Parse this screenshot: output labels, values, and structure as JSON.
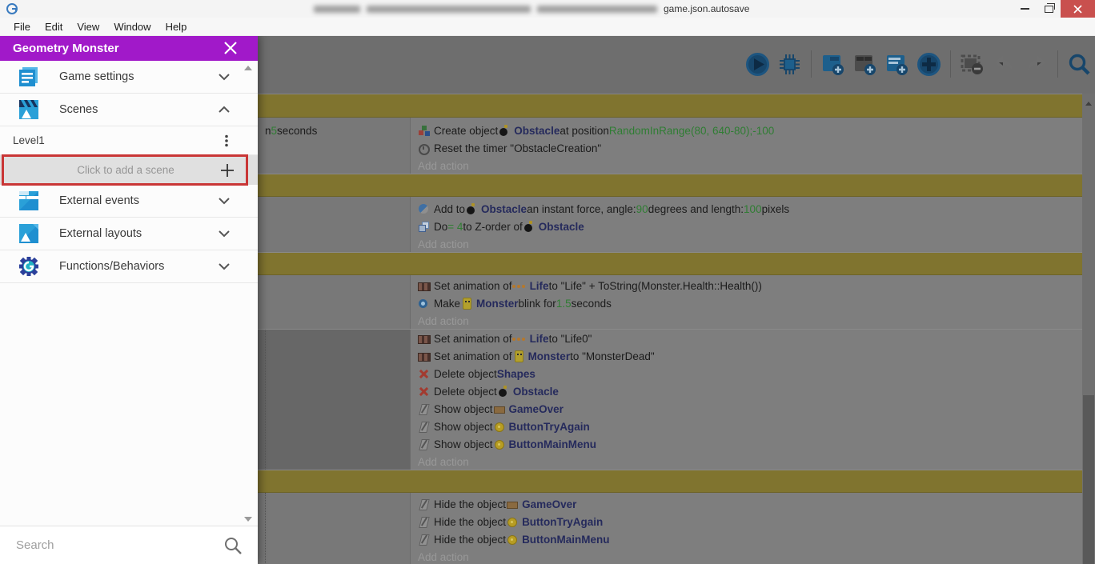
{
  "window": {
    "title_visible": "game.json.autosave",
    "controls": [
      "minimize",
      "restore",
      "close"
    ]
  },
  "menu": {
    "items": [
      "File",
      "Edit",
      "View",
      "Window",
      "Help"
    ]
  },
  "drawer": {
    "title": "Geometry Monster",
    "close_icon": "close-icon",
    "items": [
      {
        "label": "Game settings",
        "icon": "game-settings-icon",
        "chevron": "down"
      },
      {
        "label": "Scenes",
        "icon": "scenes-icon",
        "chevron": "up"
      },
      {
        "label": "Level1",
        "icon": "kebab-menu-icon"
      },
      {
        "label": "Click to add a scene",
        "icon": "plus-icon",
        "highlighted": true
      },
      {
        "label": "External events",
        "icon": "external-events-icon",
        "chevron": "down"
      },
      {
        "label": "External layouts",
        "icon": "external-layouts-icon",
        "chevron": "down"
      },
      {
        "label": "Functions/Behaviors",
        "icon": "functions-behaviors-icon",
        "chevron": "down"
      }
    ],
    "search_placeholder": "Search"
  },
  "toolbar": {
    "icons": [
      "play-icon",
      "debug-icon",
      "add-event-icon",
      "add-subevent-icon",
      "add-comment-icon",
      "add-more-icon",
      "delete-event-icon",
      "undo-icon",
      "redo-icon",
      "search-icon"
    ]
  },
  "colors": {
    "drawer_header": "#A119C9",
    "close_button": "#c9504e",
    "event_group_bar_dimmed": "#80742f",
    "object_link": "#252a5c",
    "expression_green": "#2f7d33",
    "highlight_red": "#c93636"
  },
  "events": [
    {
      "kind": "group-bar"
    },
    {
      "kind": "event",
      "condition": [
        {
          "text": "n ",
          "style": "plain"
        },
        {
          "text": "5",
          "style": "number"
        },
        {
          "text": " seconds",
          "style": "plain"
        }
      ],
      "actions": [
        [
          {
            "icon": "create-object"
          },
          {
            "text": "Create object ",
            "style": "plain"
          },
          {
            "icon": "obstacle"
          },
          {
            "text": "Obstacle",
            "style": "object"
          },
          {
            "text": " at position ",
            "style": "plain"
          },
          {
            "text": "RandomInRange(80, 640-80);-100",
            "style": "number"
          }
        ],
        [
          {
            "icon": "timer"
          },
          {
            "text": "Reset the timer \"ObstacleCreation\"",
            "style": "plain"
          }
        ],
        [
          {
            "text": "Add action",
            "style": "placeholder"
          }
        ]
      ]
    },
    {
      "kind": "group-bar"
    },
    {
      "kind": "event",
      "actions": [
        [
          {
            "icon": "force"
          },
          {
            "text": "Add to ",
            "style": "plain"
          },
          {
            "icon": "obstacle"
          },
          {
            "text": "Obstacle",
            "style": "object"
          },
          {
            "text": " an instant force, angle: ",
            "style": "plain"
          },
          {
            "text": "90",
            "style": "number"
          },
          {
            "text": " degrees and length: ",
            "style": "plain"
          },
          {
            "text": "100",
            "style": "number"
          },
          {
            "text": " pixels",
            "style": "plain"
          }
        ],
        [
          {
            "icon": "z-order"
          },
          {
            "text": "Do ",
            "style": "plain"
          },
          {
            "text": "= 4",
            "style": "number"
          },
          {
            "text": " to Z-order of ",
            "style": "plain"
          },
          {
            "icon": "obstacle"
          },
          {
            "text": "Obstacle",
            "style": "object"
          }
        ],
        [
          {
            "text": "Add action",
            "style": "placeholder"
          }
        ]
      ]
    },
    {
      "kind": "group-bar"
    },
    {
      "kind": "event",
      "actions": [
        [
          {
            "icon": "animation"
          },
          {
            "text": "Set animation of ",
            "style": "plain"
          },
          {
            "icon": "life"
          },
          {
            "text": "Life",
            "style": "object"
          },
          {
            "text": " to \"Life\" + ToString(Monster.Health::Health())",
            "style": "plain"
          }
        ],
        [
          {
            "icon": "blink"
          },
          {
            "text": "Make ",
            "style": "plain"
          },
          {
            "icon": "monster"
          },
          {
            "text": "Monster",
            "style": "object"
          },
          {
            "text": " blink for ",
            "style": "plain"
          },
          {
            "text": "1.5",
            "style": "number"
          },
          {
            "text": " seconds",
            "style": "plain"
          }
        ],
        [
          {
            "text": "Add action",
            "style": "placeholder"
          }
        ]
      ]
    },
    {
      "kind": "sub-event",
      "actions": [
        [
          {
            "icon": "animation"
          },
          {
            "text": "Set animation of ",
            "style": "plain"
          },
          {
            "icon": "life"
          },
          {
            "text": "Life",
            "style": "object"
          },
          {
            "text": " to \"Life0\"",
            "style": "plain"
          }
        ],
        [
          {
            "icon": "animation"
          },
          {
            "text": "Set animation of ",
            "style": "plain"
          },
          {
            "icon": "monster"
          },
          {
            "text": "Monster",
            "style": "object"
          },
          {
            "text": " to \"MonsterDead\"",
            "style": "plain"
          }
        ],
        [
          {
            "icon": "delete"
          },
          {
            "text": "Delete object ",
            "style": "plain"
          },
          {
            "text": "Shapes",
            "style": "object"
          }
        ],
        [
          {
            "icon": "delete"
          },
          {
            "text": "Delete object ",
            "style": "plain"
          },
          {
            "icon": "obstacle"
          },
          {
            "text": "Obstacle",
            "style": "object"
          }
        ],
        [
          {
            "icon": "visibility"
          },
          {
            "text": "Show object ",
            "style": "plain"
          },
          {
            "icon": "game-over"
          },
          {
            "text": "GameOver",
            "style": "object"
          }
        ],
        [
          {
            "icon": "visibility"
          },
          {
            "text": "Show object ",
            "style": "plain"
          },
          {
            "icon": "yellow-button"
          },
          {
            "text": "ButtonTryAgain",
            "style": "object"
          }
        ],
        [
          {
            "icon": "visibility"
          },
          {
            "text": "Show object ",
            "style": "plain"
          },
          {
            "icon": "yellow-button"
          },
          {
            "text": "ButtonMainMenu",
            "style": "object"
          }
        ],
        [
          {
            "text": "Add action",
            "style": "placeholder"
          }
        ]
      ]
    },
    {
      "kind": "group-bar"
    },
    {
      "kind": "event",
      "dotted": true,
      "actions": [
        [
          {
            "icon": "visibility"
          },
          {
            "text": "Hide the object ",
            "style": "plain"
          },
          {
            "icon": "game-over"
          },
          {
            "text": "GameOver",
            "style": "object"
          }
        ],
        [
          {
            "icon": "visibility"
          },
          {
            "text": "Hide the object ",
            "style": "plain"
          },
          {
            "icon": "yellow-button"
          },
          {
            "text": "ButtonTryAgain",
            "style": "object"
          }
        ],
        [
          {
            "icon": "visibility"
          },
          {
            "text": "Hide the object ",
            "style": "plain"
          },
          {
            "icon": "yellow-button"
          },
          {
            "text": "ButtonMainMenu",
            "style": "object"
          }
        ],
        [
          {
            "text": "Add action",
            "style": "placeholder"
          }
        ]
      ]
    }
  ]
}
